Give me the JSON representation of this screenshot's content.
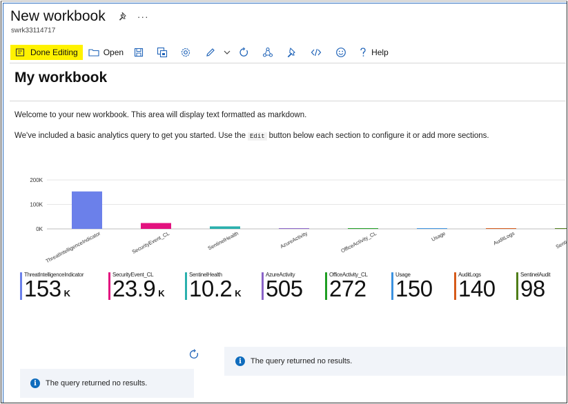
{
  "header": {
    "title": "New workbook",
    "subtitle": "swrk33114717",
    "more_label": "···"
  },
  "toolbar": {
    "done_editing_label": "Done Editing",
    "open_label": "Open",
    "help_label": "Help"
  },
  "workbook": {
    "title": "My workbook",
    "text1": "Welcome to your new workbook. This area will display text formatted as markdown.",
    "text2_before": "We've included a basic analytics query to get you started. Use the",
    "text2_code": "Edit",
    "text2_after": "button below each section to configure it or add more sections."
  },
  "chart_data": {
    "type": "bar",
    "categories": [
      "ThreatIntelligenceIndicator",
      "SecurityEvent_CL",
      "SentinelHealth",
      "AzureActivity",
      "OfficeActivity_CL",
      "Usage",
      "AuditLogs",
      "SentinelAudit"
    ],
    "values": [
      153000,
      23900,
      10200,
      505,
      272,
      150,
      140,
      98
    ],
    "colors": [
      "#6b80ea",
      "#e3127f",
      "#2ab0ad",
      "#8a63c8",
      "#1e9e22",
      "#3b92e0",
      "#d65a1a",
      "#4f7d18"
    ],
    "yticks": [
      "200K",
      "100K",
      "0K"
    ],
    "ylim": [
      0,
      200000
    ]
  },
  "tiles": [
    {
      "name": "ThreatIntelligenceIndicator",
      "value": "153",
      "unit": "K",
      "color": "#6b80ea"
    },
    {
      "name": "SecurityEvent_CL",
      "value": "23.9",
      "unit": "K",
      "color": "#e3127f"
    },
    {
      "name": "SentinelHealth",
      "value": "10.2",
      "unit": "K",
      "color": "#2ab0ad"
    },
    {
      "name": "AzureActivity",
      "value": "505",
      "unit": "",
      "color": "#8a63c8"
    },
    {
      "name": "OfficeActivity_CL",
      "value": "272",
      "unit": "",
      "color": "#1e9e22"
    },
    {
      "name": "Usage",
      "value": "150",
      "unit": "",
      "color": "#3b92e0"
    },
    {
      "name": "AuditLogs",
      "value": "140",
      "unit": "",
      "color": "#d65a1a"
    },
    {
      "name": "SentinelAudit",
      "value": "98",
      "unit": "",
      "color": "#4f7d18"
    }
  ],
  "notices": {
    "right": "The query returned no results.",
    "left": "The query returned no results."
  }
}
